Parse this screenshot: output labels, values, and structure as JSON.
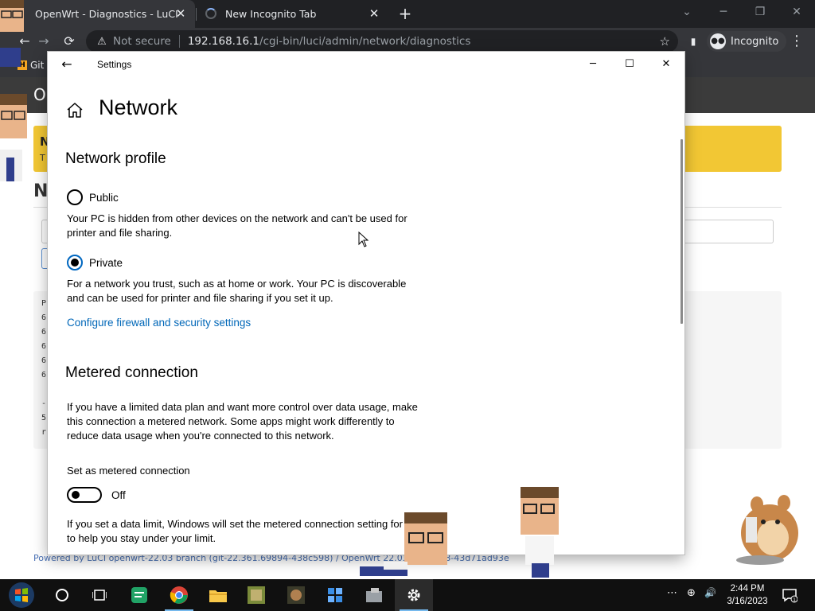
{
  "browser": {
    "tabs": [
      {
        "title": "OpenWrt - Diagnostics - LuCI",
        "close": "✕"
      },
      {
        "title": "New Incognito Tab",
        "close": "✕"
      }
    ],
    "new_tab": "+",
    "window_controls": {
      "minimize": "─",
      "restore": "❐",
      "close": "✕",
      "tab_search": "⌄"
    },
    "toolbar": {
      "back": "←",
      "forward": "→",
      "reload": "⟳",
      "security_icon": "⚠",
      "security_label": "Not secure",
      "url_host": "192.168.16.1",
      "url_path": "/cgi-bin/luci/admin/network/diagnostics",
      "bookmark_star": "☆",
      "sidebar_icon": "▮",
      "profile_label": "Incognito",
      "menu_icon": "⋮"
    },
    "bookmarks": [
      {
        "label": "Git"
      }
    ]
  },
  "luci": {
    "brand": "Op",
    "alert_title": "N",
    "alert_text": "T",
    "heading": "N",
    "output_lines": [
      "P",
      "6",
      "6",
      "6",
      "6",
      "6",
      "-",
      "5",
      "r"
    ],
    "footer": "Powered by LuCI openwrt-22.03 branch (git-22.361.69894-438c598) / OpenWrt 22.03.3 r20028-43d71ad93e"
  },
  "settings": {
    "window_title": "Settings",
    "controls": {
      "back": "←",
      "minimize": "─",
      "maximize": "☐",
      "close": "✕"
    },
    "page_title": "Network",
    "network_profile": {
      "heading": "Network profile",
      "options": [
        {
          "label": "Public",
          "description": "Your PC is hidden from other devices on the network and can't be used for printer and file sharing.",
          "checked": false
        },
        {
          "label": "Private",
          "description": "For a network you trust, such as at home or work. Your PC is discoverable and can be used for printer and file sharing if you set it up.",
          "checked": true
        }
      ],
      "firewall_link": "Configure firewall and security settings"
    },
    "metered": {
      "heading": "Metered connection",
      "description": "If you have a limited data plan and want more control over data usage, make this connection a metered network. Some apps might work differently to reduce data usage when you're connected to this network.",
      "toggle_label": "Set as metered connection",
      "toggle_state": "Off",
      "data_limit_text": "If you set a data limit, Windows will set the metered connection setting for you to help you stay under your limit."
    }
  },
  "taskbar": {
    "apps": [
      {
        "name": "start",
        "icon": "windows-logo-icon"
      },
      {
        "name": "cortana",
        "icon": "search-circle-icon"
      },
      {
        "name": "task-view",
        "icon": "task-view-icon"
      },
      {
        "name": "app-green",
        "icon": "green-app-icon"
      },
      {
        "name": "chrome",
        "icon": "chrome-icon"
      },
      {
        "name": "file-explorer",
        "icon": "folder-icon"
      },
      {
        "name": "game-1",
        "icon": "game-thumbnail-icon"
      },
      {
        "name": "game-2",
        "icon": "game-thumbnail-icon"
      },
      {
        "name": "app-blue",
        "icon": "blue-cubes-icon"
      },
      {
        "name": "app-gray",
        "icon": "gray-app-icon"
      },
      {
        "name": "settings",
        "icon": "gear-icon"
      }
    ],
    "tray": {
      "overflow": "⋯",
      "network": "⊕",
      "volume": "🔊",
      "notifications_count": "1"
    },
    "clock": {
      "time": "2:44 PM",
      "date": "3/16/2023"
    }
  },
  "colors": {
    "chrome_dark": "#202124",
    "chrome_toolbar": "#35363a",
    "luci_header": "#3b3b3b",
    "alert_yellow": "#f2c734",
    "accent_blue": "#0067c0",
    "link_blue": "#0067b8",
    "taskbar": "#101010"
  }
}
